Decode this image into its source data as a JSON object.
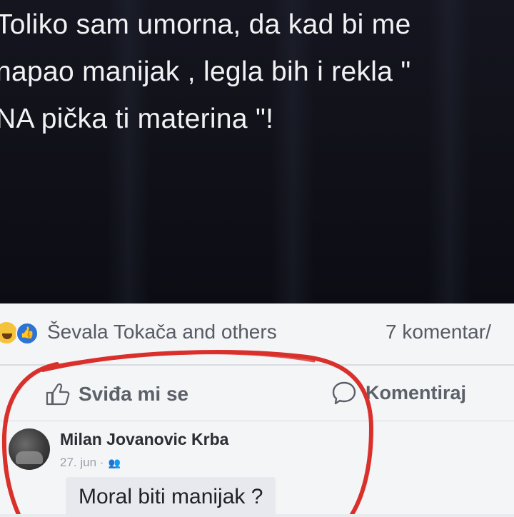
{
  "post": {
    "text_lines": [
      "Toliko sam umorna, da kad bi me",
      "napao manijak , legla bih i rekla \"",
      "NA pička ti materina \"!"
    ]
  },
  "reactions": {
    "icons": [
      "haha-reaction-icon",
      "like-reaction-icon"
    ],
    "reacted_by": "Ševala Tokača and others",
    "comment_count": "7 komentar/"
  },
  "actions": {
    "like_label": "Sviđa mi se",
    "comment_label": "Komentiraj"
  },
  "comment": {
    "author": "Milan Jovanovic Krba",
    "date": "27. jun ·",
    "audience_icon": "friends-icon",
    "text": "Moral biti manijak ?"
  },
  "colors": {
    "post_background": "#12131b",
    "annotation_red": "#d9302b",
    "like_blue": "#2a73d8"
  }
}
